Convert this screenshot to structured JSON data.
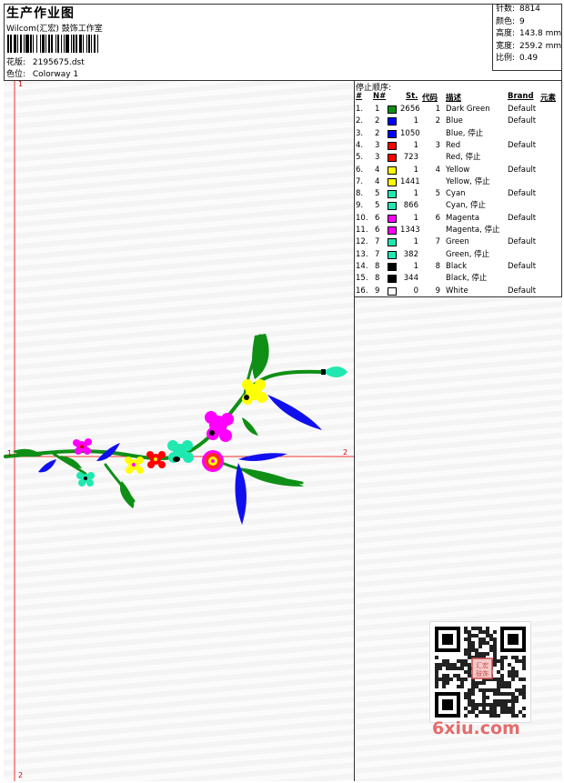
{
  "header": {
    "title": "生产作业图",
    "company": "Wilcom(汇宏) 鼓饰工作室",
    "design_label": "花版:",
    "design_value": "2195675.dst",
    "colorway_label": "色位:",
    "colorway_value": "Colorway 1"
  },
  "stats": [
    {
      "label": "针数:",
      "value": "8814"
    },
    {
      "label": "颜色:",
      "value": "9"
    },
    {
      "label": "高度:",
      "value": "143.8 mm"
    },
    {
      "label": "宽度:",
      "value": "259.2 mm"
    },
    {
      "label": "比例:",
      "value": "0.49"
    }
  ],
  "axis": {
    "start_top": "1",
    "start_left": "1",
    "end_right": "2",
    "end_bottom": "2"
  },
  "stop_table": {
    "title": "停止顺序:",
    "headers": {
      "idx": "#",
      "n": "N#",
      "st": "St.",
      "code": "代码",
      "desc": "描述",
      "brand": "Brand",
      "elem": "元素"
    },
    "rows": [
      {
        "idx": "1.",
        "n": "1",
        "color": "#0f8f16",
        "st": "2656",
        "code": "1",
        "desc": "Dark Green",
        "brand": "Default"
      },
      {
        "idx": "2.",
        "n": "2",
        "color": "#0000ff",
        "st": "1",
        "code": "2",
        "desc": "Blue",
        "brand": "Default"
      },
      {
        "idx": "3.",
        "n": "2",
        "color": "#0000ff",
        "st": "1050",
        "code": "",
        "desc": "Blue, 停止",
        "brand": ""
      },
      {
        "idx": "4.",
        "n": "3",
        "color": "#ff0000",
        "st": "1",
        "code": "3",
        "desc": "Red",
        "brand": "Default"
      },
      {
        "idx": "5.",
        "n": "3",
        "color": "#ff0000",
        "st": "723",
        "code": "",
        "desc": "Red, 停止",
        "brand": ""
      },
      {
        "idx": "6.",
        "n": "4",
        "color": "#ffff00",
        "st": "1",
        "code": "4",
        "desc": "Yellow",
        "brand": "Default"
      },
      {
        "idx": "7.",
        "n": "4",
        "color": "#ffff00",
        "st": "1441",
        "code": "",
        "desc": "Yellow, 停止",
        "brand": ""
      },
      {
        "idx": "8.",
        "n": "5",
        "color": "#20e8b0",
        "st": "1",
        "code": "5",
        "desc": "Cyan",
        "brand": "Default"
      },
      {
        "idx": "9.",
        "n": "5",
        "color": "#20e8b0",
        "st": "866",
        "code": "",
        "desc": "Cyan, 停止",
        "brand": ""
      },
      {
        "idx": "10.",
        "n": "6",
        "color": "#ff00ff",
        "st": "1",
        "code": "6",
        "desc": "Magenta",
        "brand": "Default"
      },
      {
        "idx": "11.",
        "n": "6",
        "color": "#ff00ff",
        "st": "1343",
        "code": "",
        "desc": "Magenta, 停止",
        "brand": ""
      },
      {
        "idx": "12.",
        "n": "7",
        "color": "#20e8b0",
        "st": "1",
        "code": "7",
        "desc": "Green",
        "brand": "Default"
      },
      {
        "idx": "13.",
        "n": "7",
        "color": "#20e8b0",
        "st": "382",
        "code": "",
        "desc": "Green, 停止",
        "brand": ""
      },
      {
        "idx": "14.",
        "n": "8",
        "color": "#000000",
        "st": "1",
        "code": "8",
        "desc": "Black",
        "brand": "Default"
      },
      {
        "idx": "15.",
        "n": "8",
        "color": "#000000",
        "st": "344",
        "code": "",
        "desc": "Black, 停止",
        "brand": ""
      },
      {
        "idx": "16.",
        "n": "9",
        "color": "#ffffff",
        "st": "0",
        "code": "9",
        "desc": "White",
        "brand": "Default"
      }
    ]
  },
  "watermark": {
    "text": "6xiu.com",
    "seal_text": "汇宏 鼓饰",
    "color": "#e46c6c"
  }
}
